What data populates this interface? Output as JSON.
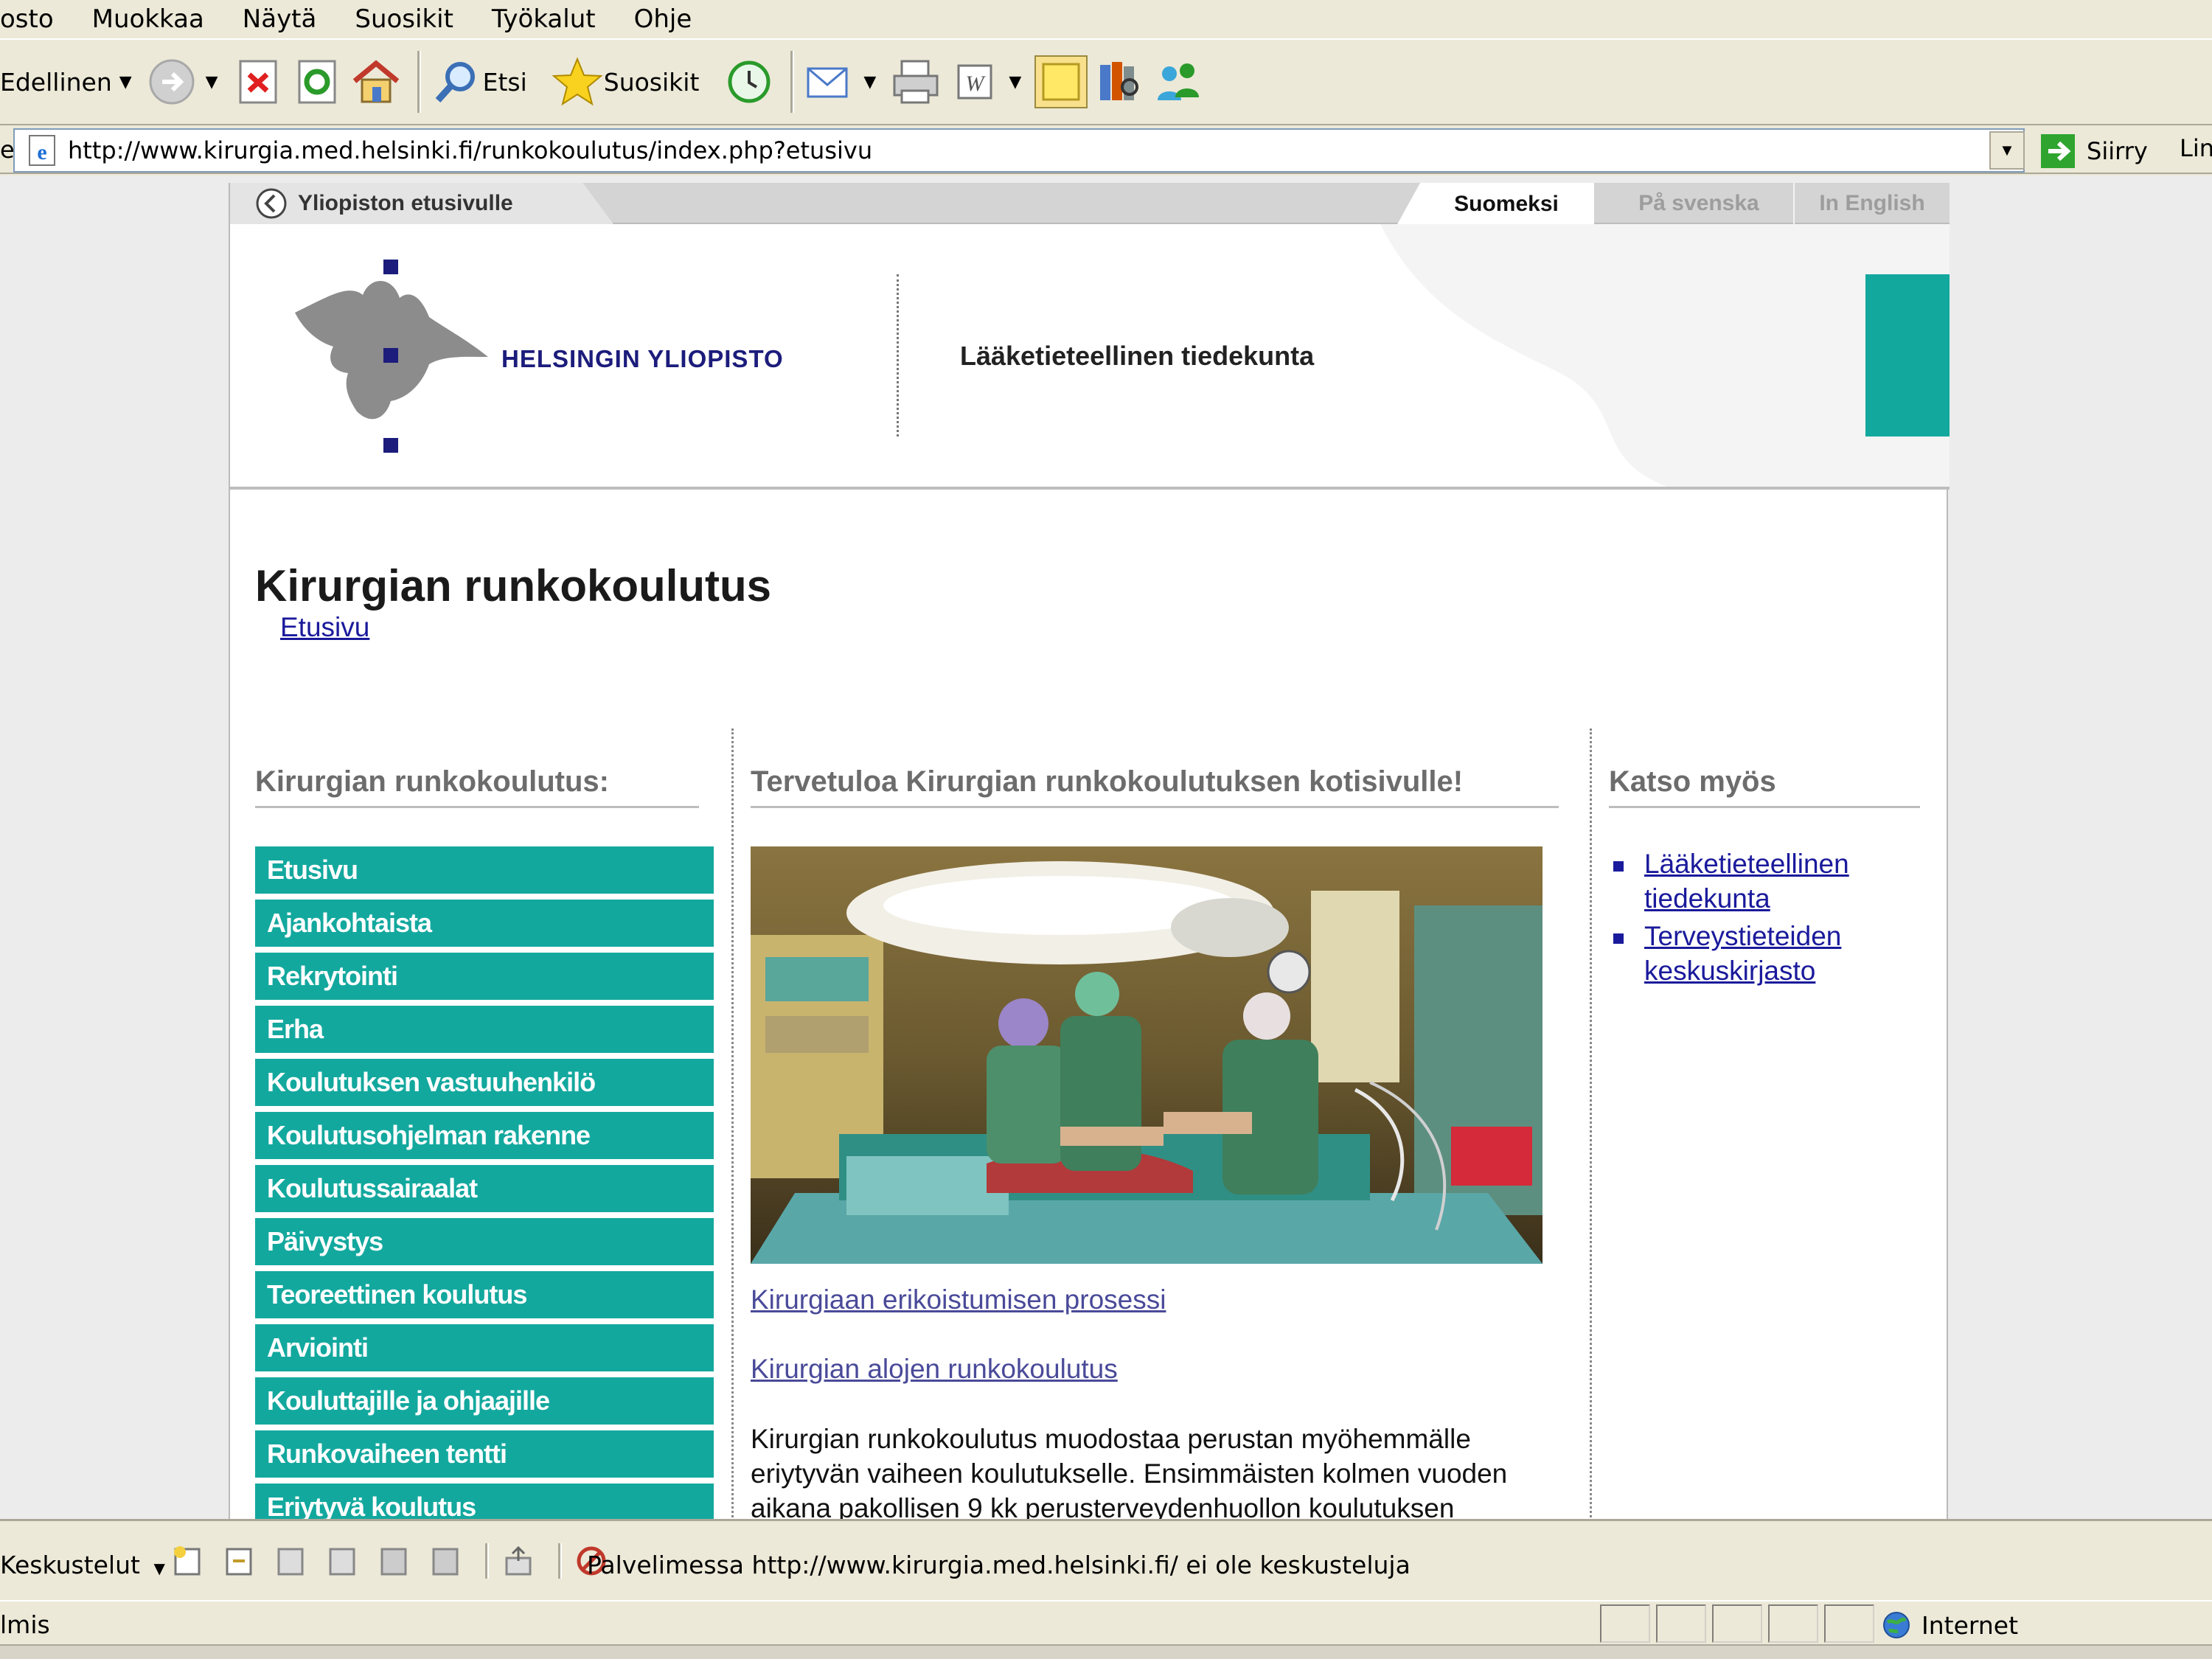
{
  "browser": {
    "menu": [
      "osto",
      "Muokkaa",
      "Näytä",
      "Suosikit",
      "Työkalut",
      "Ohje"
    ],
    "toolbar": {
      "back_label": "Edellinen",
      "search_label": "Etsi",
      "favorites_label": "Suosikit"
    },
    "address": {
      "label": "e",
      "url": "http://www.kirurgia.med.helsinki.fi/runkokoulutus/index.php?etusivu",
      "go_label": "Siirry",
      "links_label": "Lin"
    },
    "discussion": {
      "label": "Keskustelut",
      "message": "Palvelimessa http://www.kirurgia.med.helsinki.fi/ ei ole keskusteluja"
    },
    "status": {
      "text": "lmis",
      "zone": "Internet"
    }
  },
  "site": {
    "tabs": {
      "back_to_university": "Yliopiston etusivulle",
      "lang_fi": "Suomeksi",
      "lang_sv": "På svenska",
      "lang_en": "In English"
    },
    "header": {
      "logo_text": "HELSINGIN YLIOPISTO",
      "faculty": "Lääketieteellinen tiedekunta",
      "accent_color": "#13a89e"
    },
    "title": "Kirurgian runkokoulutus",
    "breadcrumb": "Etusivu",
    "left": {
      "heading": "Kirurgian runkokoulutus:",
      "nav": [
        "Etusivu",
        "Ajankohtaista",
        "Rekrytointi",
        "Erha",
        "Koulutuksen vastuuhenkilö",
        "Koulutusohjelman rakenne",
        "Koulutussairaalat",
        "Päivystys",
        "Teoreettinen koulutus",
        "Arviointi",
        "Kouluttajille ja ohjaajille",
        "Runkovaiheen tentti",
        "Eriytyvä koulutus"
      ]
    },
    "center": {
      "heading": "Tervetuloa Kirurgian runkokoulutuksen kotisivulle!",
      "link1": "Kirurgiaan erikoistumisen prosessi",
      "link2": "Kirurgian alojen runkokoulutus",
      "body_lines": [
        "Kirurgian runkokoulutus muodostaa perustan myöhemmälle",
        "eriytyvän vaiheen koulutukselle. Ensimmäisten kolmen vuoden",
        "aikana pakollisen 9 kk perusterveydenhuollon koulutuksen"
      ]
    },
    "right": {
      "heading": "Katso myös",
      "links": [
        {
          "line1": "Lääketieteellinen",
          "line2": "tiedekunta"
        },
        {
          "line1": "Terveystieteiden",
          "line2": "keskuskirjasto"
        }
      ]
    }
  }
}
